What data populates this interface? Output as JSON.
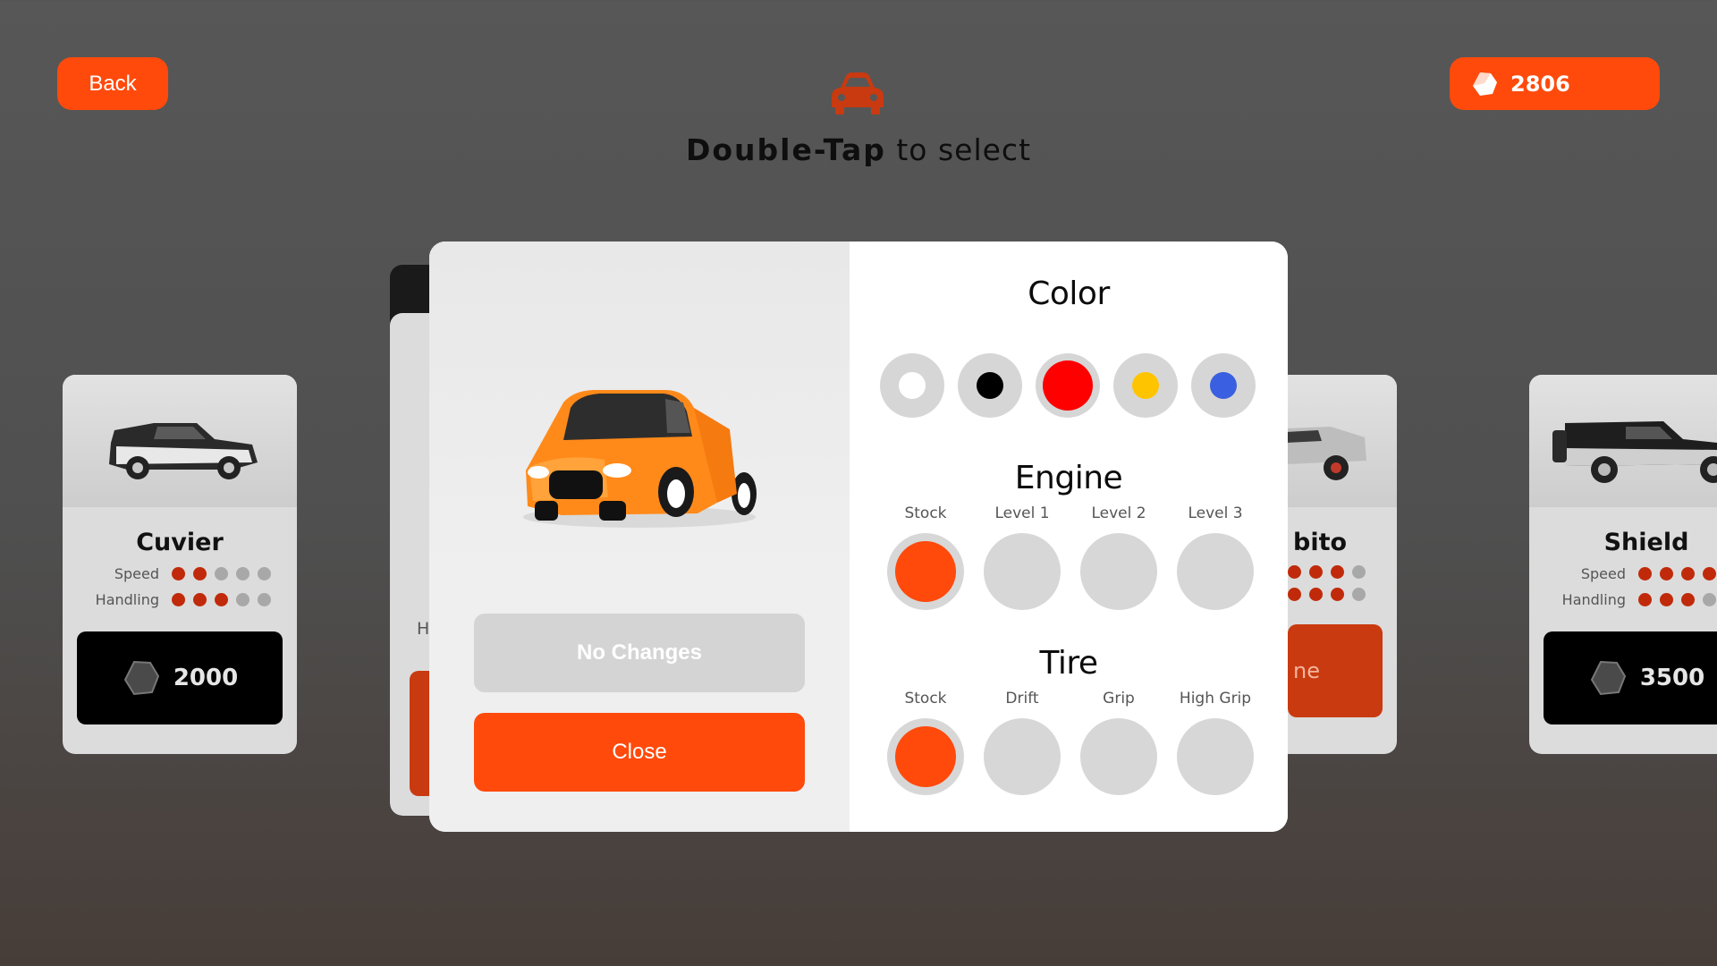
{
  "header": {
    "back_label": "Back",
    "coins": "2806",
    "hint_bold": "Double-Tap",
    "hint_rest": " to select"
  },
  "cards": [
    {
      "name": "Cuvier",
      "speed_label": "Speed",
      "handling_label": "Handling",
      "speed": 2,
      "handling": 3,
      "price": "2000"
    },
    {
      "name": "bito",
      "speed": 4,
      "handling": 4,
      "button": "ne"
    },
    {
      "name": "Shield",
      "speed_label": "Speed",
      "handling_label": "Handling",
      "speed": 4,
      "handling": 3,
      "price": "3500"
    }
  ],
  "partial_card": {
    "label": "H"
  },
  "modal": {
    "no_changes_label": "No Changes",
    "close_label": "Close",
    "color": {
      "title": "Color",
      "swatches": [
        {
          "name": "white",
          "hex": "#ffffff"
        },
        {
          "name": "black",
          "hex": "#000000"
        },
        {
          "name": "red",
          "hex": "#ff0000",
          "selected": true
        },
        {
          "name": "yellow",
          "hex": "#ffc400"
        },
        {
          "name": "blue",
          "hex": "#3a5fe0"
        }
      ]
    },
    "engine": {
      "title": "Engine",
      "options": [
        "Stock",
        "Level 1",
        "Level 2",
        "Level 3"
      ],
      "selected": 0
    },
    "tire": {
      "title": "Tire",
      "options": [
        "Stock",
        "Drift",
        "Grip",
        "High Grip"
      ],
      "selected": 0
    }
  },
  "colors": {
    "accent": "#ff4a0c",
    "inactive": "#d7d7d7",
    "stat_on": "#c02a0a"
  }
}
